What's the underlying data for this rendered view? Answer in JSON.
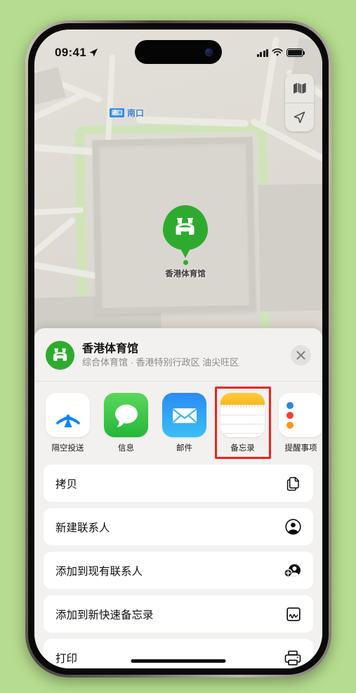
{
  "background_color": "#b6dd8f",
  "status_bar": {
    "time": "09:41",
    "location_arrow": "location-arrow-icon",
    "cellular": "signal-bars-icon",
    "wifi": "wifi-icon",
    "battery": "battery-full-icon"
  },
  "map": {
    "labels": [
      {
        "badge": "进口",
        "text": "南口"
      }
    ],
    "pin": {
      "title": "香港体育馆",
      "color": "#2eab2e",
      "glyph": "stadium-icon"
    },
    "controls": [
      {
        "name": "map-layers-icon"
      },
      {
        "name": "locate-me-icon"
      }
    ]
  },
  "share_sheet": {
    "header": {
      "title": "香港体育馆",
      "subtitle": "综合体育馆 · 香港特别行政区 油尖旺区",
      "icon_color": "#2eab2e",
      "close_label": "✕"
    },
    "apps": [
      {
        "label": "隔空投送",
        "icon": "airdrop-icon",
        "highlighted": false
      },
      {
        "label": "信息",
        "icon": "messages-icon",
        "highlighted": false
      },
      {
        "label": "邮件",
        "icon": "mail-icon",
        "highlighted": false
      },
      {
        "label": "备忘录",
        "icon": "notes-icon",
        "highlighted": true
      },
      {
        "label": "提醒事项",
        "icon": "reminders-icon",
        "highlighted": false
      }
    ],
    "highlight_color": "#f32119",
    "actions": [
      {
        "label": "拷贝",
        "icon": "copy-icon"
      },
      {
        "label": "新建联系人",
        "icon": "person-circle-icon"
      },
      {
        "label": "添加到现有联系人",
        "icon": "person-add-icon"
      },
      {
        "label": "添加到新快速备忘录",
        "icon": "quick-note-icon"
      },
      {
        "label": "打印",
        "icon": "printer-icon"
      }
    ]
  }
}
